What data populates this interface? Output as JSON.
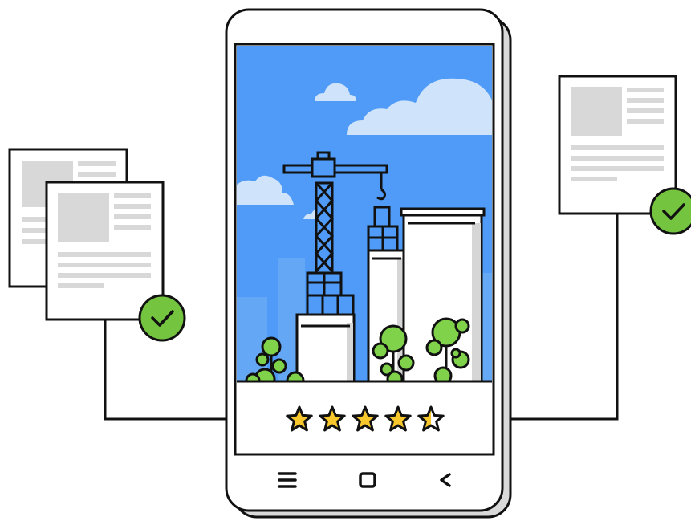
{
  "colors": {
    "outline": "#111111",
    "sky": "#4f9bf7",
    "sky_shade": "#5aa4f8",
    "cloud": "#cfe3fb",
    "building_bg": "#67a9f2",
    "building": "#ffffff",
    "building_shadow": "#d6d6d6",
    "tree": "#7fd24a",
    "tree_dark": "#6cbf3a",
    "star": "#f7c72c",
    "check_badge": "#74c43f",
    "doc_placeholder": "#d8d8d8",
    "phone_body": "#ffffff",
    "phone_shadow": "#d9d9d9"
  },
  "rating": {
    "value": 4.5,
    "max": 5
  },
  "phone": {
    "nav_buttons": [
      "menu-icon",
      "home-square-icon",
      "back-chevron-icon"
    ]
  },
  "documents": [
    {
      "side": "left",
      "stacked": true,
      "verified": true
    },
    {
      "side": "right",
      "stacked": false,
      "verified": true
    }
  ]
}
